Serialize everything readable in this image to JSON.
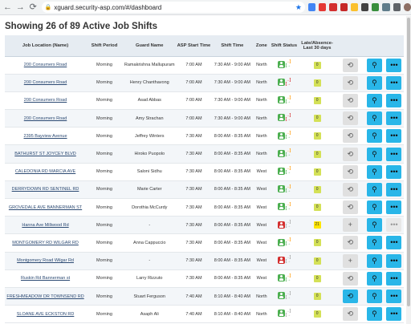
{
  "browser": {
    "url": "xguard.security-asp.com/#/dashboard"
  },
  "page": {
    "title": "Showing 26 of 89 Active Job Shifts"
  },
  "colors": {
    "header_bg": "#e6ecf2",
    "action_blue": "#29b6e8",
    "status_green": "#4caf50",
    "status_red": "#d32f2f"
  },
  "table": {
    "headers": [
      "Job Location (Name)",
      "Shift Period",
      "Guard Name",
      "ASP Start Time",
      "Shift Time",
      "Zone",
      "Shift Status",
      "Late/Absence- Last 30 days",
      "",
      "",
      ""
    ],
    "rows": [
      {
        "loc": "200 Consumers Road",
        "period": "Morning",
        "guard": "Ramakrishna Mallupuram",
        "asp": "7:00 AM",
        "time": "7:30 AM - 9:00 AM",
        "zone": "North",
        "status": "green",
        "in": "#ff9800",
        "out": "#4caf50",
        "badge": "0",
        "btn1": "grey",
        "btn3": "blue"
      },
      {
        "loc": "200 Consumers Road",
        "period": "Morning",
        "guard": "Henry Chanthavong",
        "asp": "7:00 AM",
        "time": "7:30 AM - 9:00 AM",
        "zone": "North",
        "status": "green",
        "in": "#d32f2f",
        "out": "#d32f2f",
        "badge": "0",
        "btn1": "grey",
        "btn3": "blue"
      },
      {
        "loc": "200 Consumers Road",
        "period": "Morning",
        "guard": "Asad Abbas",
        "asp": "7:00 AM",
        "time": "7:30 AM - 9:00 AM",
        "zone": "North",
        "status": "green",
        "in": "#ff9800",
        "out": "#4caf50",
        "badge": "0",
        "btn1": "grey",
        "btn3": "blue"
      },
      {
        "loc": "200 Consumers Road",
        "period": "Morning",
        "guard": "Amy Strachan",
        "asp": "7:00 AM",
        "time": "7:30 AM - 9:00 AM",
        "zone": "North",
        "status": "green",
        "in": "#d32f2f",
        "out": "#d32f2f",
        "badge": "0",
        "btn1": "grey",
        "btn3": "blue"
      },
      {
        "loc": "2395 Bayview Avenue",
        "period": "Morning",
        "guard": "Jeffrey Winters",
        "asp": "7:30 AM",
        "time": "8:00 AM - 8:35 AM",
        "zone": "North",
        "status": "green",
        "in": "#ff9800",
        "out": "#4caf50",
        "badge": "0",
        "btn1": "grey",
        "btn3": "blue"
      },
      {
        "loc": "BATHURST ST JOYCEY BLVD",
        "period": "Morning",
        "guard": "Hiroko Puopolo",
        "asp": "7:30 AM",
        "time": "8:00 AM - 8:35 AM",
        "zone": "North",
        "status": "green",
        "in": "#ff9800",
        "out": "#4caf50",
        "badge": "0",
        "btn1": "grey",
        "btn3": "blue"
      },
      {
        "loc": "CALEDONIA RD MARCIA AVE",
        "period": "Morning",
        "guard": "Saloni Sidhu",
        "asp": "7:30 AM",
        "time": "8:00 AM - 8:35 AM",
        "zone": "West",
        "status": "green",
        "in": "#ff9800",
        "out": "#4caf50",
        "badge": "0",
        "btn1": "grey",
        "btn3": "blue"
      },
      {
        "loc": "DERRYDOWN RD SENTINEL RD",
        "period": "Morning",
        "guard": "Marie Carter",
        "asp": "7:30 AM",
        "time": "8:00 AM - 8:35 AM",
        "zone": "West",
        "status": "green",
        "in": "#ff9800",
        "out": "#4caf50",
        "badge": "0",
        "btn1": "grey",
        "btn3": "blue"
      },
      {
        "loc": "GROVEDALE AVE BANNERMAN ST",
        "period": "Morning",
        "guard": "Dorothia McCurdy",
        "asp": "7:30 AM",
        "time": "8:00 AM - 8:35 AM",
        "zone": "West",
        "status": "green",
        "in": "#ff9800",
        "out": "#4caf50",
        "badge": "0",
        "btn1": "grey",
        "btn3": "blue"
      },
      {
        "loc": "Hanna Ave Millwood Rd",
        "period": "Morning",
        "guard": "-",
        "asp": "7:30 AM",
        "time": "8:00 AM - 8:35 AM",
        "zone": "West",
        "status": "red",
        "in": "#9e9e9e",
        "out": "#9e9e9e",
        "badge": "21",
        "btn1": "plus",
        "btn3": "dim"
      },
      {
        "loc": "MONTGOMERY RD WILGAR RD",
        "period": "Morning",
        "guard": "Anna Cappuccio",
        "asp": "7:30 AM",
        "time": "8:00 AM - 8:35 AM",
        "zone": "West",
        "status": "green",
        "in": "#ff9800",
        "out": "#4caf50",
        "badge": "0",
        "btn1": "grey",
        "btn3": "blue"
      },
      {
        "loc": "Montgomery Road Wilgar Rd",
        "period": "Morning",
        "guard": "-",
        "asp": "7:30 AM",
        "time": "8:00 AM - 8:35 AM",
        "zone": "West",
        "status": "red",
        "in": "#9e9e9e",
        "out": "#9e9e9e",
        "badge": "0",
        "btn1": "plus",
        "btn3": "blue"
      },
      {
        "loc": "Ruskin Rd Bannerman st",
        "period": "Morning",
        "guard": "Larry Rizzuto",
        "asp": "7:30 AM",
        "time": "8:00 AM - 8:35 AM",
        "zone": "West",
        "status": "green",
        "in": "#ff9800",
        "out": "#4caf50",
        "badge": "0",
        "btn1": "grey",
        "btn3": "blue"
      },
      {
        "loc": "FRESHMEADOW DR TOWNSEND RD",
        "period": "Morning",
        "guard": "Stuart Ferguson",
        "asp": "7:40 AM",
        "time": "8:10 AM - 8:40 AM",
        "zone": "North",
        "status": "green",
        "in": "#9e9e9e",
        "out": "#9e9e9e",
        "badge": "0",
        "btn1": "blue",
        "btn3": "blue"
      },
      {
        "loc": "SLOANE AVE ECKSTON RD",
        "period": "Morning",
        "guard": "Asaph Ali",
        "asp": "7:40 AM",
        "time": "8:10 AM - 8:40 AM",
        "zone": "North",
        "status": "green",
        "in": "#9e9e9e",
        "out": "#9e9e9e",
        "badge": "0",
        "btn1": "grey",
        "btn3": "blue"
      }
    ]
  },
  "icons": {
    "reassign": "reassign-icon",
    "map": "map-pin-icon",
    "more": "more-icon",
    "add": "add-icon"
  }
}
